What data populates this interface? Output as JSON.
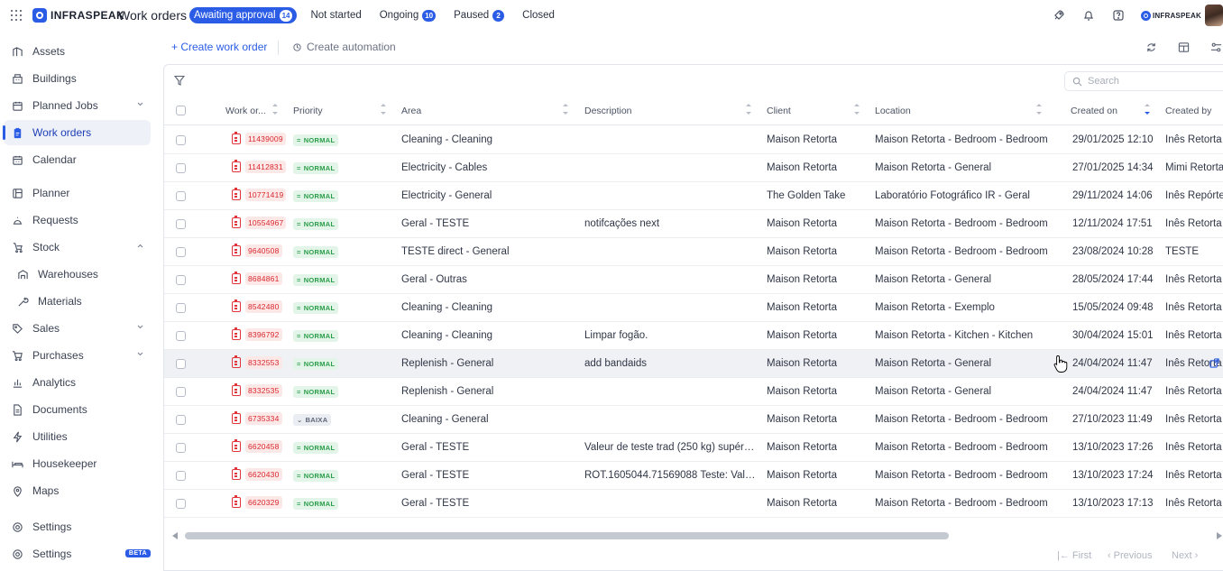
{
  "header": {
    "brand": "INFRASPEAK",
    "app_title": "Work orders",
    "tabs": [
      {
        "label": "Awaiting approval",
        "count": "14",
        "active": true
      },
      {
        "label": "Not started",
        "count": null
      },
      {
        "label": "Ongoing",
        "count": "10"
      },
      {
        "label": "Paused",
        "count": "2"
      },
      {
        "label": "Closed",
        "count": null
      }
    ],
    "small_brand": "INFRASPEAK",
    "icons": [
      "rocket-icon",
      "bell-icon",
      "help-icon"
    ]
  },
  "sidebar": {
    "items": [
      {
        "label": "Assets",
        "icon": "assets-icon"
      },
      {
        "label": "Buildings",
        "icon": "building-icon"
      },
      {
        "label": "Planned Jobs",
        "icon": "calendar-check-icon",
        "chevron": "down"
      },
      {
        "label": "Work orders",
        "icon": "clipboard-icon",
        "active": true
      },
      {
        "label": "Calendar",
        "icon": "calendar-icon"
      },
      {
        "label": "Planner",
        "icon": "planner-icon"
      },
      {
        "label": "Requests",
        "icon": "bell-request-icon"
      },
      {
        "label": "Stock",
        "icon": "stock-icon",
        "chevron": "up"
      },
      {
        "label": "Warehouses",
        "icon": "warehouse-icon",
        "sub": true
      },
      {
        "label": "Materials",
        "icon": "wrench-icon",
        "sub": true
      },
      {
        "label": "Sales",
        "icon": "tag-icon",
        "chevron": "down"
      },
      {
        "label": "Purchases",
        "icon": "cart-icon",
        "chevron": "down"
      },
      {
        "label": "Analytics",
        "icon": "chart-icon"
      },
      {
        "label": "Documents",
        "icon": "document-icon"
      },
      {
        "label": "Utilities",
        "icon": "bolt-icon"
      },
      {
        "label": "Housekeeper",
        "icon": "bed-icon"
      },
      {
        "label": "Maps",
        "icon": "map-pin-icon"
      }
    ],
    "settings": {
      "label": "Settings"
    },
    "settings_beta": {
      "label": "Settings",
      "badge": "BETA"
    }
  },
  "toolbar": {
    "create_label": "+ Create work order",
    "automation_label": "Create automation",
    "search_placeholder": "Search"
  },
  "table": {
    "columns": [
      "Work or...",
      "Priority",
      "Area",
      "Description",
      "Client",
      "Location",
      "Created on",
      "Created by"
    ],
    "rows": [
      {
        "wo": "11439009",
        "priority": "NORMAL",
        "area": "Cleaning - Cleaning",
        "description": "",
        "client": "Maison Retorta",
        "location": "Maison Retorta - Bedroom - Bedroom",
        "created_on": "29/01/2025 12:10",
        "created_by": "Inês Retorta"
      },
      {
        "wo": "11412831",
        "priority": "NORMAL",
        "area": "Electricity - Cables",
        "description": "",
        "client": "Maison Retorta",
        "location": "Maison Retorta - General",
        "created_on": "27/01/2025 14:34",
        "created_by": "Mimi Retorta"
      },
      {
        "wo": "10771419",
        "priority": "NORMAL",
        "area": "Electricity - General",
        "description": "",
        "client": "The Golden Take",
        "location": "Laboratório Fotográfico IR - Geral",
        "created_on": "29/11/2024 14:06",
        "created_by": "Inês Repórte"
      },
      {
        "wo": "10554967",
        "priority": "NORMAL",
        "area": "Geral - TESTE",
        "description": "notifcações next",
        "client": "Maison Retorta",
        "location": "Maison Retorta - Bedroom - Bedroom",
        "created_on": "12/11/2024 17:51",
        "created_by": "Inês Retorta"
      },
      {
        "wo": "9640508",
        "priority": "NORMAL",
        "area": "TESTE direct - General",
        "description": "",
        "client": "Maison Retorta",
        "location": "Maison Retorta - Bedroom - Bedroom",
        "created_on": "23/08/2024 10:28",
        "created_by": "TESTE"
      },
      {
        "wo": "8684861",
        "priority": "NORMAL",
        "area": "Geral - Outras",
        "description": "",
        "client": "Maison Retorta",
        "location": "Maison Retorta - General",
        "created_on": "28/05/2024 17:44",
        "created_by": "Inês Retorta"
      },
      {
        "wo": "8542480",
        "priority": "NORMAL",
        "area": "Cleaning - Cleaning",
        "description": "",
        "client": "Maison Retorta",
        "location": "Maison Retorta - Exemplo",
        "created_on": "15/05/2024 09:48",
        "created_by": "Inês Retorta"
      },
      {
        "wo": "8396792",
        "priority": "NORMAL",
        "area": "Cleaning - Cleaning",
        "description": "Limpar fogão.",
        "client": "Maison Retorta",
        "location": "Maison Retorta - Kitchen - Kitchen",
        "created_on": "30/04/2024 15:01",
        "created_by": "Inês Retorta"
      },
      {
        "wo": "8332553",
        "priority": "NORMAL",
        "area": "Replenish - General",
        "description": "add bandaids",
        "client": "Maison Retorta",
        "location": "Maison Retorta - General",
        "created_on": "24/04/2024 11:47",
        "created_by": "Inês Retorta",
        "hover": true
      },
      {
        "wo": "8332535",
        "priority": "NORMAL",
        "area": "Replenish - General",
        "description": "",
        "client": "Maison Retorta",
        "location": "Maison Retorta - General",
        "created_on": "24/04/2024 11:47",
        "created_by": "Inês Retorta"
      },
      {
        "wo": "6735334",
        "priority": "BAIXA",
        "area": "Cleaning - General",
        "description": "",
        "client": "Maison Retorta",
        "location": "Maison Retorta - Bedroom - Bedroom",
        "created_on": "27/10/2023 11:49",
        "created_by": "Inês Retorta"
      },
      {
        "wo": "6620458",
        "priority": "NORMAL",
        "area": "Geral - TESTE",
        "description": "Valeur de teste trad (250 kg) supérie...",
        "client": "Maison Retorta",
        "location": "Maison Retorta - Bedroom - Bedroom",
        "created_on": "13/10/2023 17:26",
        "created_by": "Inês Retorta"
      },
      {
        "wo": "6620430",
        "priority": "NORMAL",
        "area": "Geral - TESTE",
        "description": "ROT.1605044.71569088 Teste: Value...",
        "client": "Maison Retorta",
        "location": "Maison Retorta - Bedroom - Bedroom",
        "created_on": "13/10/2023 17:24",
        "created_by": "Inês Retorta"
      },
      {
        "wo": "6620329",
        "priority": "NORMAL",
        "area": "Geral - TESTE",
        "description": "",
        "client": "Maison Retorta",
        "location": "Maison Retorta - Bedroom - Bedroom",
        "created_on": "13/10/2023 17:13",
        "created_by": "Inês Retorta"
      }
    ]
  },
  "pagination": {
    "first": "First",
    "previous": "Previous",
    "next": "Next"
  },
  "colors": {
    "accent": "#2b5ce6",
    "wo_red": "#d8262c",
    "normal_green": "#2a9d4a"
  }
}
